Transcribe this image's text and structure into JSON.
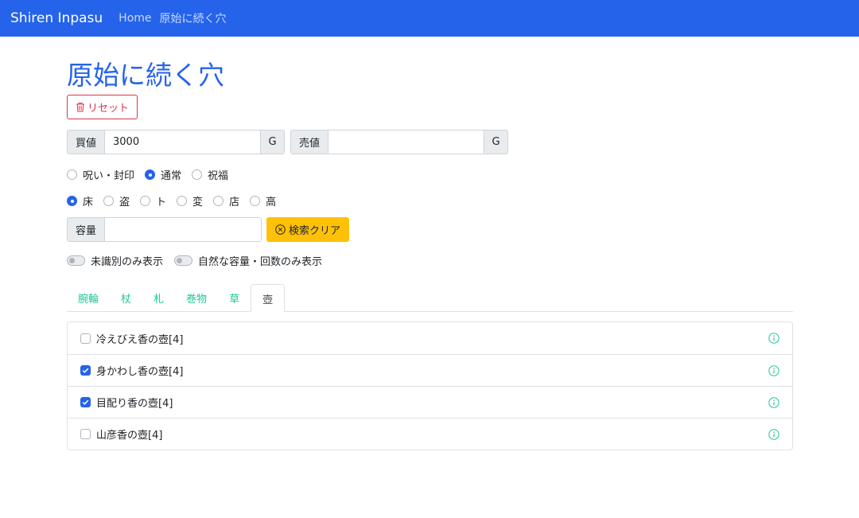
{
  "navbar": {
    "brand": "Shiren Inpasu",
    "links": [
      "Home",
      "原始に続く穴"
    ]
  },
  "page_title": "原始に続く穴",
  "reset_label": "リセット",
  "buy": {
    "label": "買値",
    "value": "3000",
    "unit": "G"
  },
  "sell": {
    "label": "売値",
    "value": "",
    "unit": "G"
  },
  "curse_options": [
    {
      "label": "呪い・封印",
      "checked": false
    },
    {
      "label": "通常",
      "checked": true
    },
    {
      "label": "祝福",
      "checked": false
    }
  ],
  "location_options": [
    {
      "label": "床",
      "checked": true
    },
    {
      "label": "盗",
      "checked": false
    },
    {
      "label": "ト",
      "checked": false
    },
    {
      "label": "変",
      "checked": false
    },
    {
      "label": "店",
      "checked": false
    },
    {
      "label": "高",
      "checked": false
    }
  ],
  "capacity": {
    "label": "容量",
    "value": ""
  },
  "search_clear_label": "検索クリア",
  "switches": [
    {
      "label": "未識別のみ表示",
      "on": false
    },
    {
      "label": "自然な容量・回数のみ表示",
      "on": false
    }
  ],
  "tabs": [
    {
      "label": "腕輪",
      "active": false
    },
    {
      "label": "杖",
      "active": false
    },
    {
      "label": "札",
      "active": false
    },
    {
      "label": "巻物",
      "active": false
    },
    {
      "label": "草",
      "active": false
    },
    {
      "label": "壺",
      "active": true
    }
  ],
  "items": [
    {
      "label": "冷えびえ香の壺[4]",
      "checked": false
    },
    {
      "label": "身かわし香の壺[4]",
      "checked": true
    },
    {
      "label": "目配り香の壺[4]",
      "checked": true
    },
    {
      "label": "山彦香の壺[4]",
      "checked": false
    }
  ],
  "colors": {
    "primary": "#2563eb",
    "danger": "#dc3545",
    "warning": "#ffc107",
    "tab_link": "#20c997",
    "info_icon": "#20c997"
  }
}
